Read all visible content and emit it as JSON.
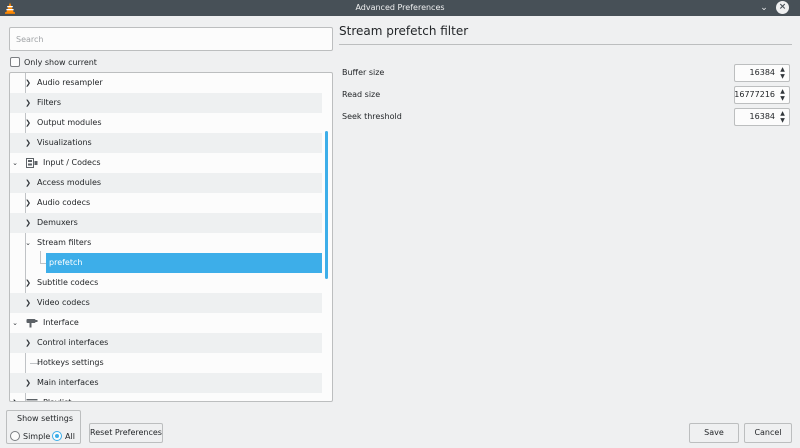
{
  "window": {
    "title": "Advanced Preferences"
  },
  "search": {
    "placeholder": "Search"
  },
  "only_show_current": {
    "label": "Only show current",
    "checked": false
  },
  "tree": {
    "items": [
      {
        "label": "Audio resampler",
        "level": 1,
        "expanded": false
      },
      {
        "label": "Filters",
        "level": 1,
        "expanded": false
      },
      {
        "label": "Output modules",
        "level": 1,
        "expanded": false
      },
      {
        "label": "Visualizations",
        "level": 1,
        "expanded": false
      },
      {
        "label": "Input / Codecs",
        "level": 0,
        "expanded": true,
        "icon": "input-codecs-icon"
      },
      {
        "label": "Access modules",
        "level": 1,
        "expanded": false
      },
      {
        "label": "Audio codecs",
        "level": 1,
        "expanded": false
      },
      {
        "label": "Demuxers",
        "level": 1,
        "expanded": false
      },
      {
        "label": "Stream filters",
        "level": 1,
        "expanded": true
      },
      {
        "label": "prefetch",
        "level": 2,
        "selected": true
      },
      {
        "label": "Subtitle codecs",
        "level": 1,
        "expanded": false
      },
      {
        "label": "Video codecs",
        "level": 1,
        "expanded": false
      },
      {
        "label": "Interface",
        "level": 0,
        "expanded": true,
        "icon": "interface-icon"
      },
      {
        "label": "Control interfaces",
        "level": 1,
        "expanded": false
      },
      {
        "label": "Hotkeys settings",
        "level": 1,
        "leaf": true
      },
      {
        "label": "Main interfaces",
        "level": 1,
        "expanded": false
      },
      {
        "label": "Playlist",
        "level": 0,
        "expanded": false,
        "icon": "playlist-icon"
      }
    ]
  },
  "panel": {
    "title": "Stream prefetch filter",
    "fields": [
      {
        "label": "Buffer size",
        "value": "16384"
      },
      {
        "label": "Read size",
        "value": "16777216"
      },
      {
        "label": "Seek threshold",
        "value": "16384"
      }
    ]
  },
  "show_settings": {
    "title": "Show settings",
    "simple_label": "Simple",
    "all_label": "All",
    "selected": "All"
  },
  "buttons": {
    "reset": "Reset Preferences",
    "save": "Save",
    "cancel": "Cancel"
  },
  "colors": {
    "accent": "#3daee9",
    "titlebar": "#475057"
  }
}
